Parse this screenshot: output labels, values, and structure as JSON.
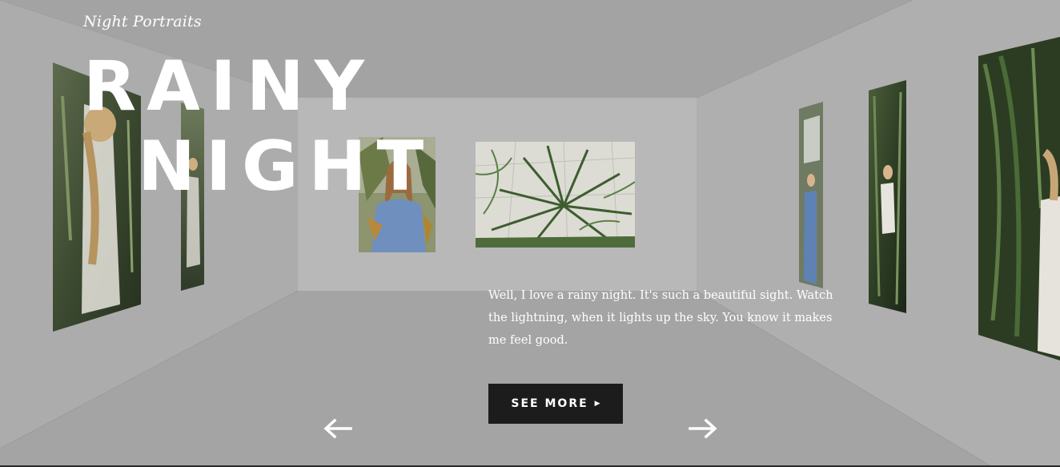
{
  "hero": {
    "subtitle": "Night Portraits",
    "title_line1": "RAINY",
    "title_line2": "NIGHT",
    "description": "Well, I love a rainy night. It's such a beautiful sight. Watch the lightning, when it lights up the sky. You know it makes me feel good."
  },
  "actions": {
    "see_more_label": "SEE MORE",
    "see_more_icon": "caret-right-icon",
    "prev_icon": "arrow-left-icon",
    "next_icon": "arrow-right-icon"
  },
  "gallery": {
    "photos": [
      {
        "subject": "woman-in-straw-hat-greenhouse",
        "wall": "left"
      },
      {
        "subject": "woman-white-dress-greenhouse",
        "wall": "left"
      },
      {
        "subject": "smiling-woman-blue-dress",
        "wall": "back"
      },
      {
        "subject": "palm-leaves-greenhouse",
        "wall": "back"
      },
      {
        "subject": "woman-blue-dress-standing",
        "wall": "right"
      },
      {
        "subject": "woman-white-dress-plants",
        "wall": "right"
      },
      {
        "subject": "woman-in-jungle",
        "wall": "right"
      }
    ]
  },
  "colors": {
    "background": "#a6a6a6",
    "ceiling": "#a3a3a3",
    "back_wall": "#b8b8b8",
    "side_walls": "#acacac",
    "floor": "#a4a4a4",
    "button": "#1c1c1c",
    "text": "#ffffff"
  }
}
